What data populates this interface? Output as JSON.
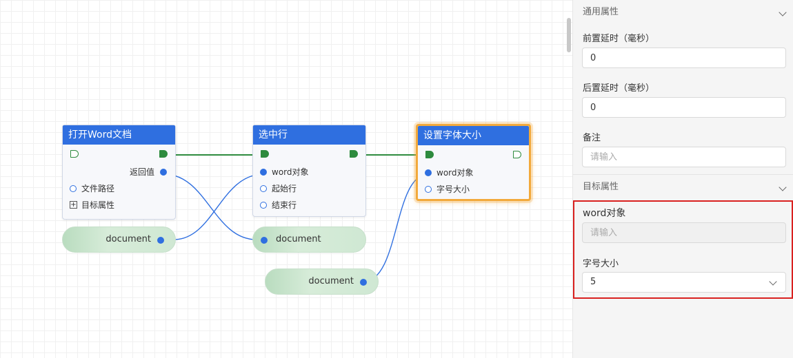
{
  "canvas": {
    "nodes": [
      {
        "id": "open-word",
        "title": "打开Word文档",
        "outputs": [
          {
            "label": "返回值"
          }
        ],
        "inputs": [
          {
            "label": "文件路径"
          }
        ],
        "expand_label": "目标属性"
      },
      {
        "id": "select-row",
        "title": "选中行",
        "inputs": [
          {
            "label": "word对象"
          },
          {
            "label": "起始行"
          },
          {
            "label": "结束行"
          }
        ]
      },
      {
        "id": "set-font-size",
        "title": "设置字体大小",
        "inputs": [
          {
            "label": "word对象"
          },
          {
            "label": "字号大小"
          }
        ]
      }
    ],
    "variables": [
      {
        "label": "document"
      },
      {
        "label": "document"
      },
      {
        "label": "document"
      }
    ],
    "colors": {
      "node_header": "#2f6fe0",
      "flow_edge": "#2e8b3e",
      "data_edge": "#2f6fe0",
      "selected_border": "#f2a93b",
      "highlight": "#d9201f"
    }
  },
  "panel": {
    "general_section": {
      "title": "通用属性",
      "icon": "chevron-down-icon",
      "fields": [
        {
          "label": "前置延时（毫秒）",
          "value": "0"
        },
        {
          "label": "后置延时（毫秒）",
          "value": "0"
        },
        {
          "label": "备注",
          "value": "",
          "placeholder": "请输入"
        }
      ]
    },
    "target_section": {
      "title": "目标属性",
      "icon": "chevron-down-icon",
      "fields": [
        {
          "label": "word对象",
          "value": "",
          "placeholder": "请输入"
        },
        {
          "label": "字号大小",
          "value": "5"
        }
      ]
    }
  }
}
